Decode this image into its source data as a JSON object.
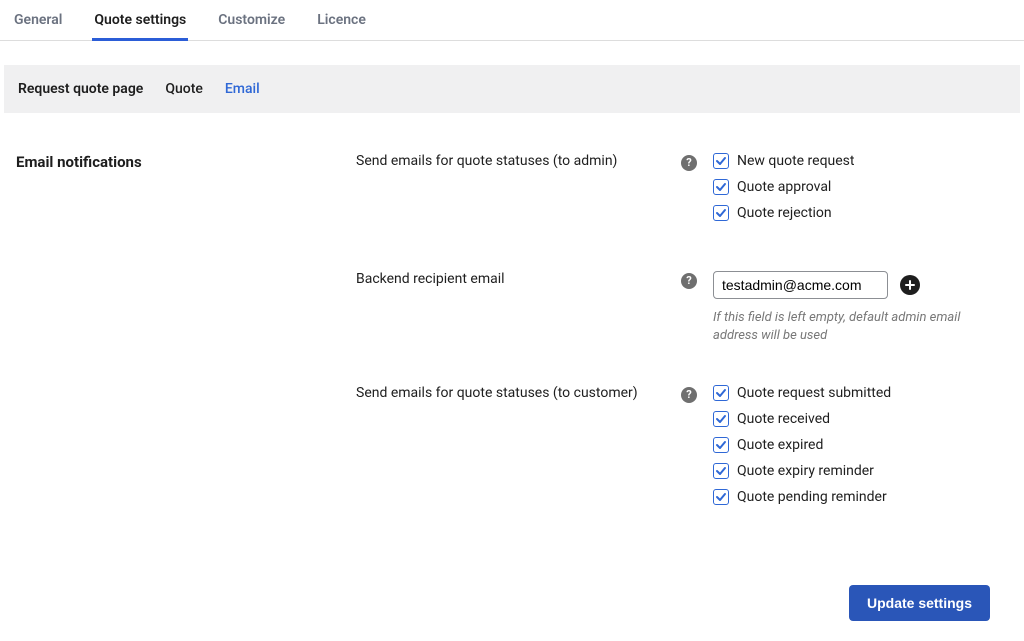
{
  "tabs": {
    "items": [
      "General",
      "Quote settings",
      "Customize",
      "Licence"
    ],
    "active_index": 1
  },
  "subtabs": {
    "items": [
      "Request quote page",
      "Quote",
      "Email"
    ],
    "active_index": 2
  },
  "section": {
    "title": "Email notifications"
  },
  "settings": {
    "admin_statuses": {
      "label": "Send emails for quote statuses (to admin)",
      "options": [
        {
          "label": "New quote request",
          "checked": true
        },
        {
          "label": "Quote approval",
          "checked": true
        },
        {
          "label": "Quote rejection",
          "checked": true
        }
      ]
    },
    "backend_email": {
      "label": "Backend recipient email",
      "value": "testadmin@acme.com",
      "helper": "If this field is left empty, default admin email address will be used"
    },
    "customer_statuses": {
      "label": "Send emails for quote statuses (to customer)",
      "options": [
        {
          "label": "Quote request submitted",
          "checked": true
        },
        {
          "label": "Quote received",
          "checked": true
        },
        {
          "label": "Quote expired",
          "checked": true
        },
        {
          "label": "Quote expiry reminder",
          "checked": true
        },
        {
          "label": "Quote pending reminder",
          "checked": true
        }
      ]
    }
  },
  "actions": {
    "update": "Update settings"
  }
}
